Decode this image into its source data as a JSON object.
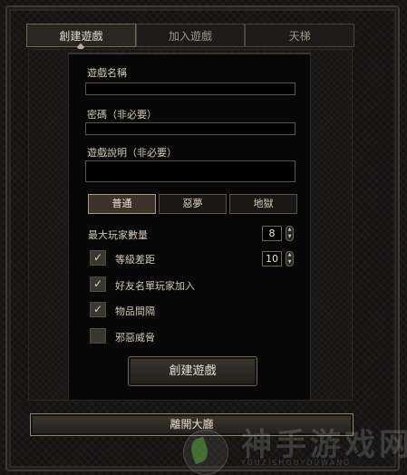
{
  "tabs": [
    {
      "label": "創建遊戲",
      "active": true
    },
    {
      "label": "加入遊戲",
      "active": false
    },
    {
      "label": "天梯",
      "active": false
    }
  ],
  "form": {
    "game_name_label": "遊戲名稱",
    "game_name_value": "",
    "password_label": "密碼（非必要）",
    "password_value": "",
    "description_label": "遊戲說明（非必要）",
    "description_value": ""
  },
  "difficulty": {
    "options": [
      "普通",
      "惡夢",
      "地獄"
    ],
    "selected": "普通"
  },
  "settings": {
    "max_players_label": "最大玩家數量",
    "max_players_value": "8",
    "level_diff_label": "等級差距",
    "level_diff_value": "10",
    "level_diff_checked": true,
    "friends_only_label": "好友名單玩家加入",
    "friends_only_checked": true,
    "item_interval_label": "物品間隔",
    "item_interval_checked": true,
    "terror_label": "邪惡威脅",
    "terror_checked": false
  },
  "buttons": {
    "create": "創建遊戲",
    "leave": "離開大廳"
  },
  "watermark": {
    "text": "神手游戏网",
    "sub": "YOUZISHOUYOUWANG"
  },
  "icons": {
    "check": "✓",
    "stepper_up": "▲",
    "stepper_down": "▼"
  }
}
